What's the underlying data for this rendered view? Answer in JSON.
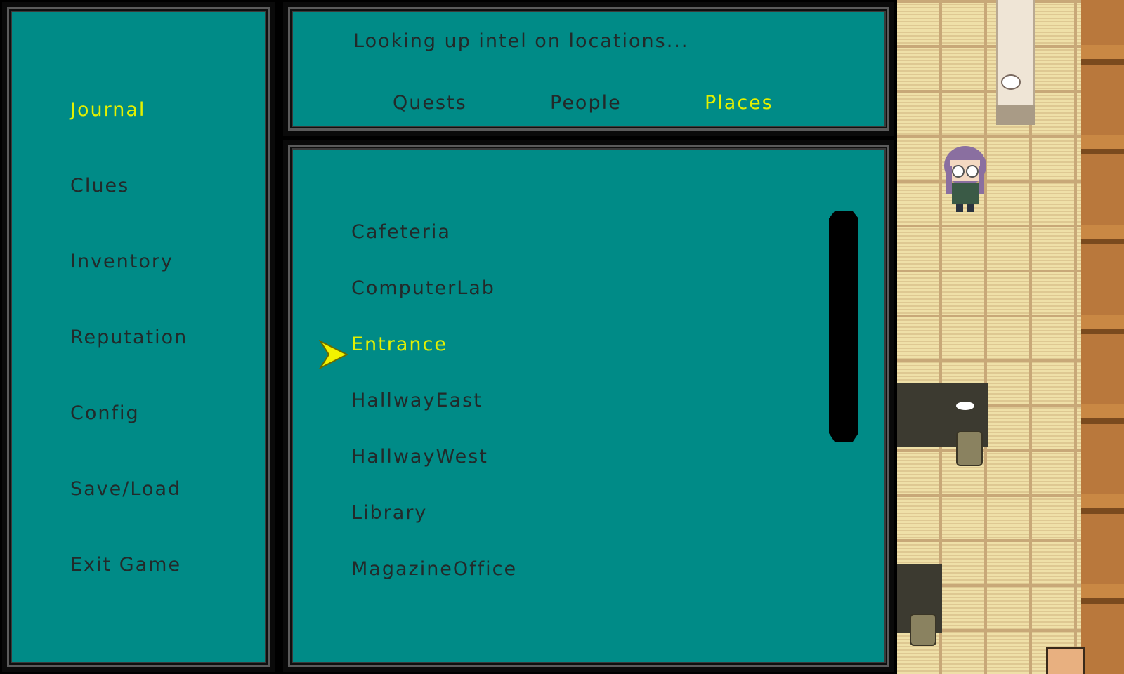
{
  "menu": {
    "items": [
      {
        "label": "Journal",
        "selected": true
      },
      {
        "label": "Clues",
        "selected": false
      },
      {
        "label": "Inventory",
        "selected": false
      },
      {
        "label": "Reputation",
        "selected": false
      },
      {
        "label": "Config",
        "selected": false
      },
      {
        "label": "Save/Load",
        "selected": false
      },
      {
        "label": "Exit Game",
        "selected": false
      }
    ]
  },
  "journal": {
    "header": "Looking up intel on locations...",
    "tabs": [
      {
        "label": "Quests",
        "selected": false
      },
      {
        "label": "People",
        "selected": false
      },
      {
        "label": "Places",
        "selected": true
      }
    ],
    "places": [
      {
        "label": "Cafeteria",
        "selected": false
      },
      {
        "label": "ComputerLab",
        "selected": false
      },
      {
        "label": "Entrance",
        "selected": true
      },
      {
        "label": "HallwayEast",
        "selected": false
      },
      {
        "label": "HallwayWest",
        "selected": false
      },
      {
        "label": "Library",
        "selected": false
      },
      {
        "label": "MagazineOffice",
        "selected": false
      }
    ]
  },
  "colors": {
    "panel_bg": "#008b87",
    "text": "#222a2a",
    "highlight": "#e4f000",
    "frame": "#0a0a0a",
    "floor": "#efe0a8"
  },
  "icons": {
    "cursor": "selection-arrow-icon",
    "scrollbar": "scrollbar-thumb"
  }
}
